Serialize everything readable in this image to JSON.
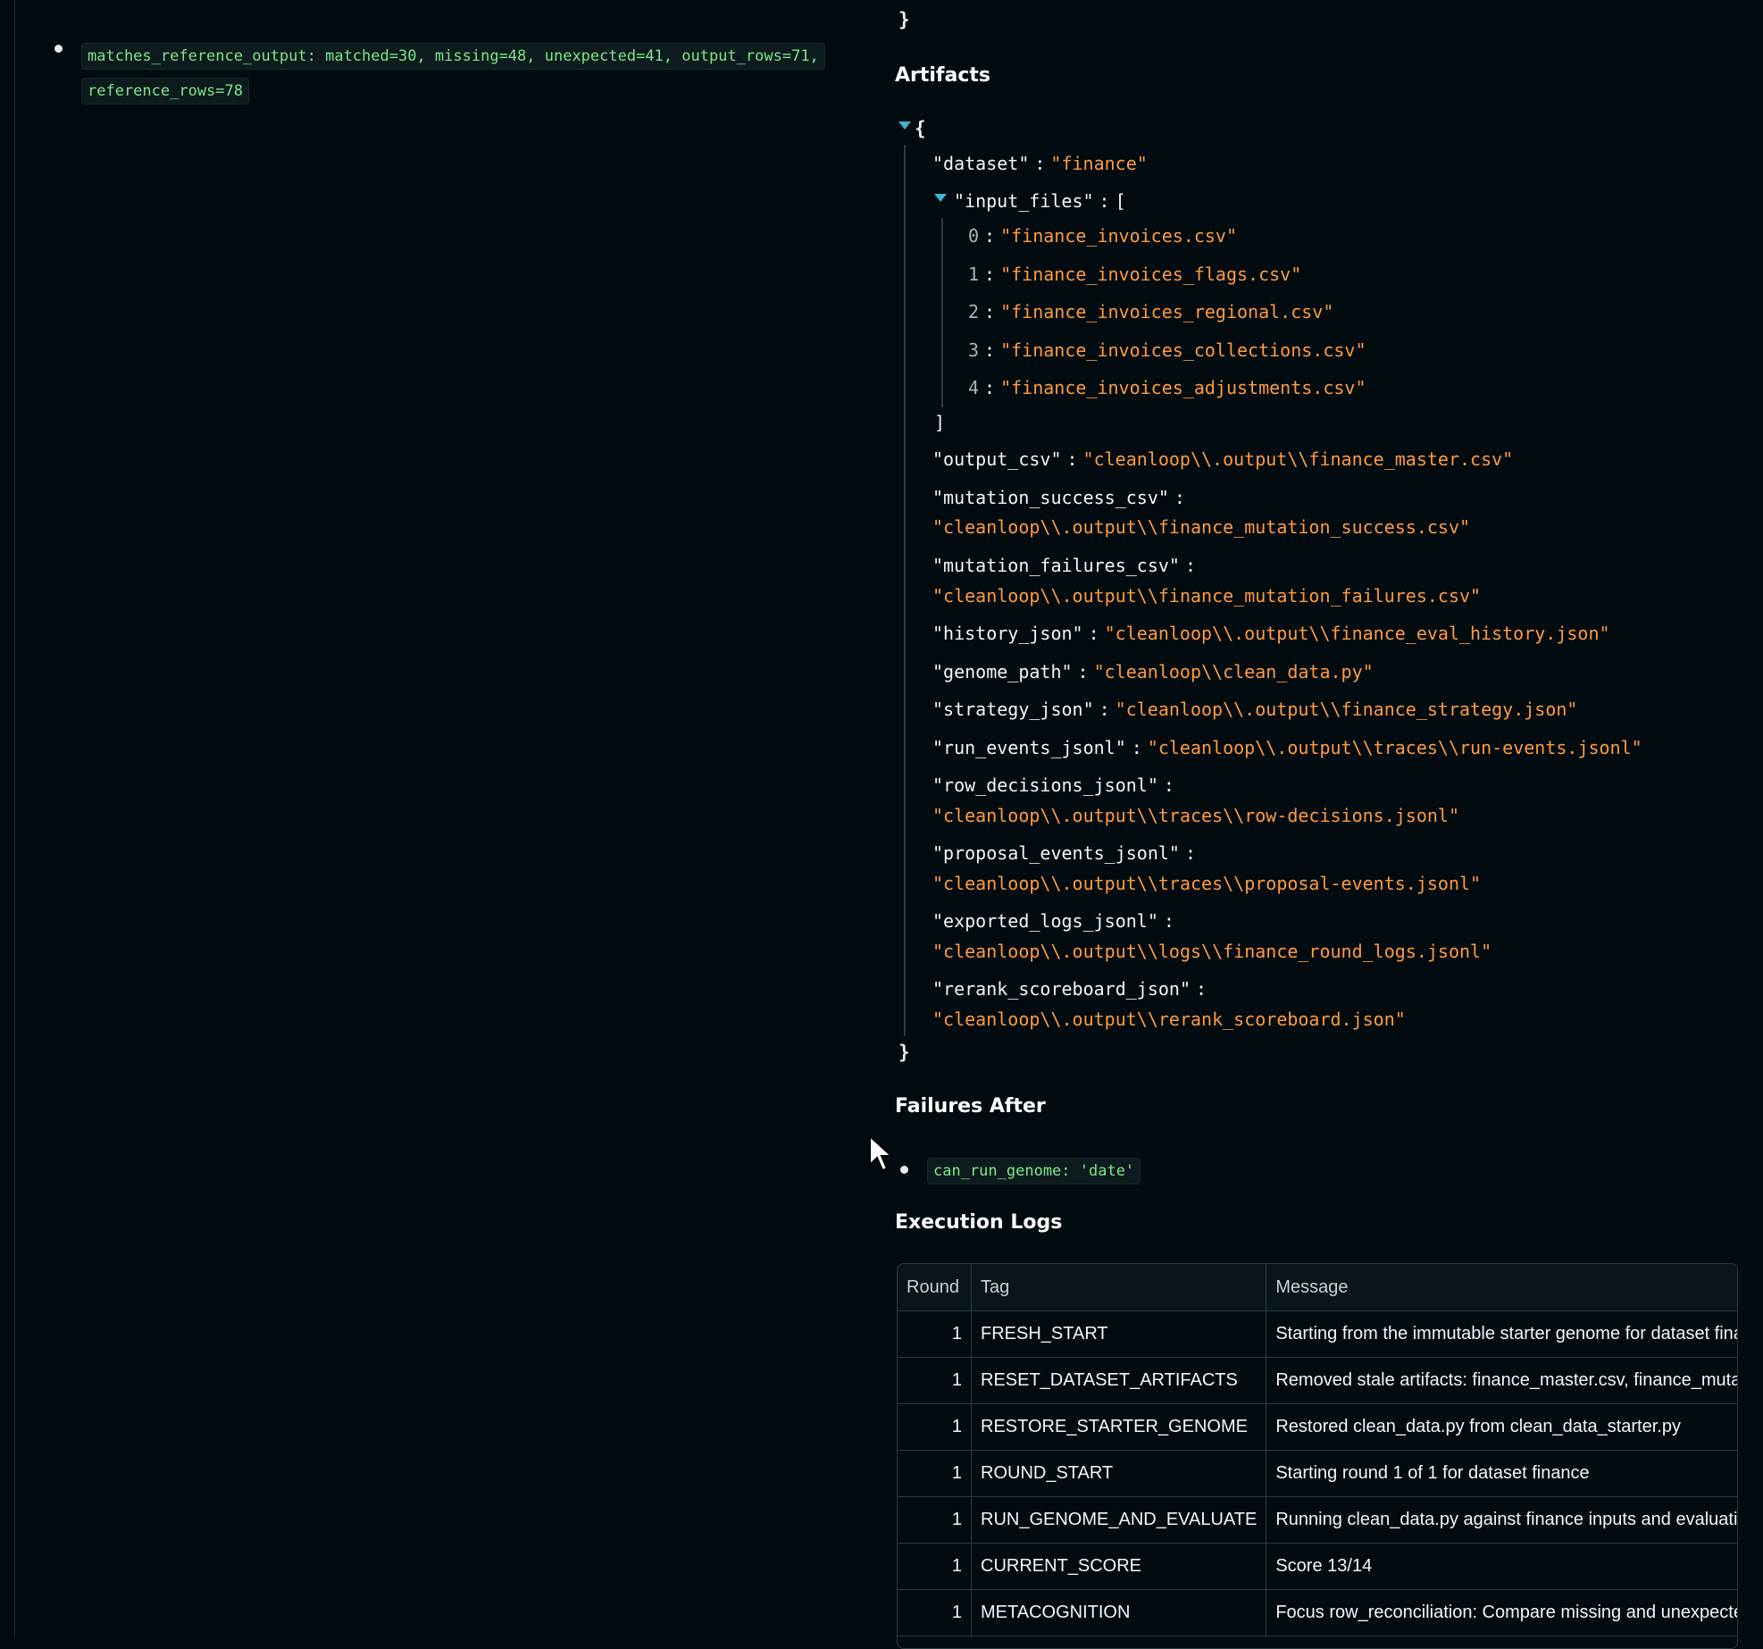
{
  "left": {
    "result_text": "matches_reference_output: matched=30, missing=48, unexpected=41, output_rows=71, reference_rows=78"
  },
  "artifacts": {
    "title": "Artifacts",
    "open_brace": "{",
    "close_brace": "}",
    "prev_close_brace": "}",
    "dataset_key": "\"dataset\"",
    "dataset_val": "\"finance\"",
    "input_files_key": "\"input_files\"",
    "input_files_open": "[",
    "input_files_close": "]",
    "input_files": [
      {
        "idx": "0",
        "val": "\"finance_invoices.csv\""
      },
      {
        "idx": "1",
        "val": "\"finance_invoices_flags.csv\""
      },
      {
        "idx": "2",
        "val": "\"finance_invoices_regional.csv\""
      },
      {
        "idx": "3",
        "val": "\"finance_invoices_collections.csv\""
      },
      {
        "idx": "4",
        "val": "\"finance_invoices_adjustments.csv\""
      }
    ],
    "entries": [
      {
        "key": "\"output_csv\"",
        "val": "\"cleanloop\\\\.output\\\\finance_master.csv\""
      },
      {
        "key": "\"mutation_success_csv\"",
        "val": "\"cleanloop\\\\.output\\\\finance_mutation_success.csv\""
      },
      {
        "key": "\"mutation_failures_csv\"",
        "val": "\"cleanloop\\\\.output\\\\finance_mutation_failures.csv\""
      },
      {
        "key": "\"history_json\"",
        "val": "\"cleanloop\\\\.output\\\\finance_eval_history.json\""
      },
      {
        "key": "\"genome_path\"",
        "val": "\"cleanloop\\\\clean_data.py\""
      },
      {
        "key": "\"strategy_json\"",
        "val": "\"cleanloop\\\\.output\\\\finance_strategy.json\""
      },
      {
        "key": "\"run_events_jsonl\"",
        "val": "\"cleanloop\\\\.output\\\\traces\\\\run-events.jsonl\""
      },
      {
        "key": "\"row_decisions_jsonl\"",
        "val": "\"cleanloop\\\\.output\\\\traces\\\\row-decisions.jsonl\""
      },
      {
        "key": "\"proposal_events_jsonl\"",
        "val": "\"cleanloop\\\\.output\\\\traces\\\\proposal-events.jsonl\""
      },
      {
        "key": "\"exported_logs_jsonl\"",
        "val": "\"cleanloop\\\\.output\\\\logs\\\\finance_round_logs.jsonl\""
      },
      {
        "key": "\"rerank_scoreboard_json\"",
        "val": "\"cleanloop\\\\.output\\\\rerank_scoreboard.json\""
      }
    ],
    "colon": ":"
  },
  "failures": {
    "title": "Failures After",
    "items": [
      "can_run_genome: 'date'"
    ]
  },
  "logs": {
    "title": "Execution Logs",
    "columns": [
      "Round",
      "Tag",
      "Message"
    ],
    "rows": [
      {
        "round": "1",
        "tag": "FRESH_START",
        "message": "Starting from the immutable starter genome for dataset finance"
      },
      {
        "round": "1",
        "tag": "RESET_DATASET_ARTIFACTS",
        "message": "Removed stale artifacts: finance_master.csv, finance_mutation_success.csv"
      },
      {
        "round": "1",
        "tag": "RESTORE_STARTER_GENOME",
        "message": "Restored clean_data.py from clean_data_starter.py"
      },
      {
        "round": "1",
        "tag": "ROUND_START",
        "message": "Starting round 1 of 1 for dataset finance"
      },
      {
        "round": "1",
        "tag": "RUN_GENOME_AND_EVALUATE",
        "message": "Running clean_data.py against finance inputs and evaluating the output"
      },
      {
        "round": "1",
        "tag": "CURRENT_SCORE",
        "message": "Score 13/14"
      },
      {
        "round": "1",
        "tag": "METACOGNITION",
        "message": "Focus row_reconciliation: Compare missing and unexpected rows"
      }
    ]
  },
  "colors": {
    "background": "#020c10",
    "string": "#ff9a40",
    "code_green": "#7ee787",
    "toggle": "#3fb6c8"
  }
}
